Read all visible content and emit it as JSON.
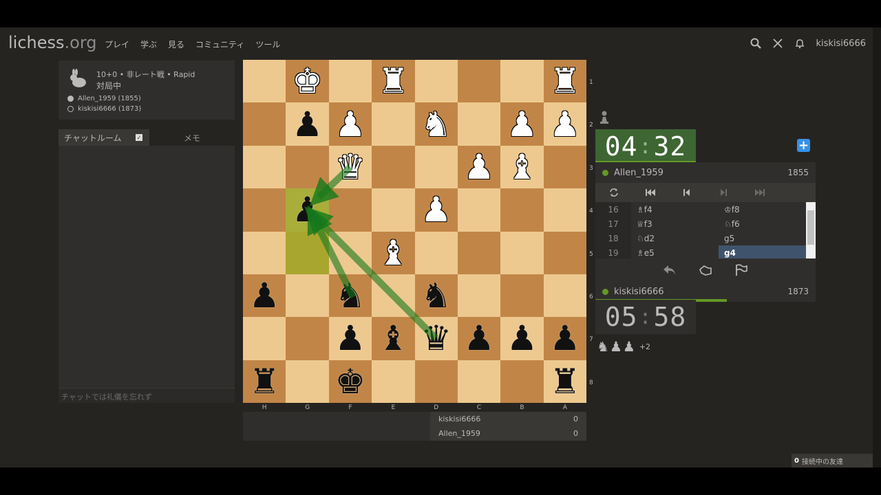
{
  "header": {
    "logo_main": "lichess",
    "logo_tld": ".org",
    "nav": [
      "プレイ",
      "学ぶ",
      "見る",
      "コミュニティ",
      "ツール"
    ],
    "username": "kiskisi6666"
  },
  "game_info": {
    "title": "10+0 • 非レート戦 • Rapid",
    "status": "対局中",
    "white_player": "Allen_1959 (1855)",
    "black_player": "kiskisi6666 (1873)"
  },
  "chat": {
    "tab_chat": "チャットルーム",
    "tab_notes": "メモ",
    "placeholder": "チャットでは礼儀を忘れず"
  },
  "board": {
    "orientation": "black",
    "rank_labels": [
      "1",
      "2",
      "3",
      "4",
      "5",
      "6",
      "7",
      "8"
    ],
    "file_labels": [
      "H",
      "G",
      "F",
      "E",
      "D",
      "C",
      "B",
      "A"
    ],
    "rows": [
      [
        "",
        "wK",
        "",
        "wR",
        "",
        "",
        "",
        "wR"
      ],
      [
        "",
        "bP",
        "wP",
        "",
        "wN",
        "",
        "wP",
        "wP"
      ],
      [
        "",
        "",
        "wQ",
        "",
        "",
        "wP",
        "wB",
        ""
      ],
      [
        "",
        "bP",
        "",
        "",
        "wP",
        "",
        "",
        ""
      ],
      [
        "",
        "",
        "",
        "wB",
        "",
        "",
        "",
        ""
      ],
      [
        "bP",
        "",
        "bN",
        "",
        "bN",
        "",
        "",
        ""
      ],
      [
        "",
        "",
        "bP",
        "bB",
        "bQ",
        "bP",
        "bP",
        "bP"
      ],
      [
        "bR",
        "",
        "bK",
        "",
        "",
        "",
        "",
        "bR"
      ]
    ],
    "highlights": [
      [
        3,
        1
      ],
      [
        4,
        1
      ]
    ],
    "arrow_color": "#15781b"
  },
  "score": {
    "rows": [
      {
        "name": "kiskisi6666",
        "score": "0"
      },
      {
        "name": "Allen_1959",
        "score": "0"
      }
    ]
  },
  "clocks": {
    "top_min": "04",
    "top_sec": "32",
    "bottom_min": "05",
    "bottom_sec": "58",
    "sep": ":"
  },
  "players": {
    "top": {
      "name": "Allen_1959",
      "rating": "1855"
    },
    "bottom": {
      "name": "kiskisi6666",
      "rating": "1873"
    }
  },
  "moves": [
    {
      "num": "16",
      "white": "♗f4",
      "black": "♔f8"
    },
    {
      "num": "17",
      "white": "♕f3",
      "black": "♘f6"
    },
    {
      "num": "18",
      "white": "♘d2",
      "black": "g5"
    },
    {
      "num": "19",
      "white": "♗e5",
      "black": "g4"
    }
  ],
  "captured": {
    "pieces": [
      "♞",
      "♟",
      "♟"
    ],
    "diff": "+2"
  },
  "friends": {
    "count": "0",
    "label": "接続中の友達"
  },
  "icons": {
    "flip": "flip-icon",
    "first": "first-move-icon",
    "prev": "prev-move-icon",
    "next": "next-move-icon",
    "last": "last-move-icon",
    "takeback": "takeback-icon",
    "draw": "draw-offer-icon",
    "resign": "resign-flag-icon"
  }
}
